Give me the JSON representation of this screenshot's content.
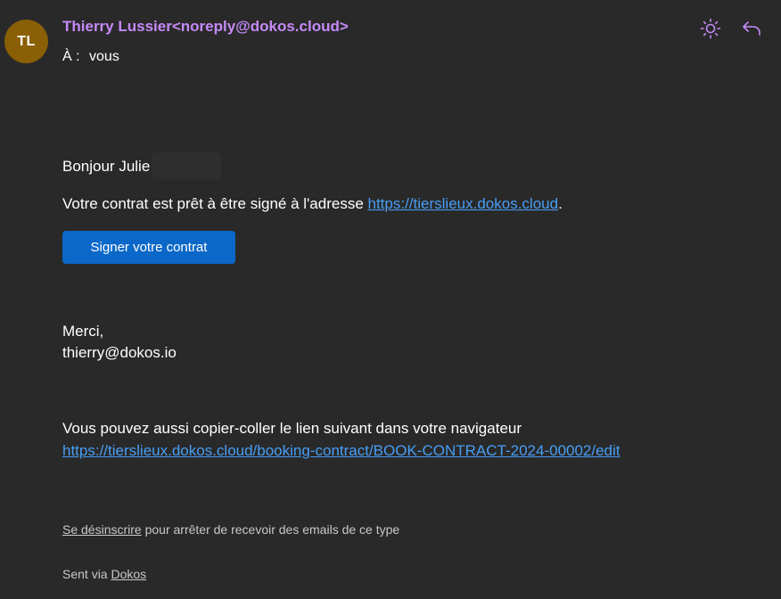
{
  "header": {
    "avatar_initials": "TL",
    "avatar_color": "#8a5f06",
    "sender": "Thierry Lussier<noreply@dokos.cloud>",
    "sender_color": "#c58af9",
    "to_label": "À :",
    "to_value": "vous",
    "icons": {
      "theme": "sun-icon",
      "reply": "reply-icon"
    }
  },
  "message": {
    "greeting": "Bonjour Julie",
    "contract_text": "Votre contrat est prêt à être signé à l'adresse ",
    "contract_link": "https://tierslieux.dokos.cloud",
    "contract_suffix": ".",
    "sign_button": "Signer votre contrat",
    "button_color": "#0b68c8",
    "thanks": "Merci,",
    "signature_email": "thierry@dokos.io",
    "copy_paste_text": "Vous pouvez aussi copier-coller le lien suivant dans votre navigateur",
    "full_link": "https://tierslieux.dokos.cloud/booking-contract/BOOK-CONTRACT-2024-00002/edit",
    "link_color": "#479ef5"
  },
  "footer": {
    "unsubscribe_link": "Se désinscrire",
    "unsubscribe_text": " pour arrêter de recevoir des emails de ce type",
    "sent_via_text": "Sent via ",
    "sent_via_link": "Dokos"
  }
}
